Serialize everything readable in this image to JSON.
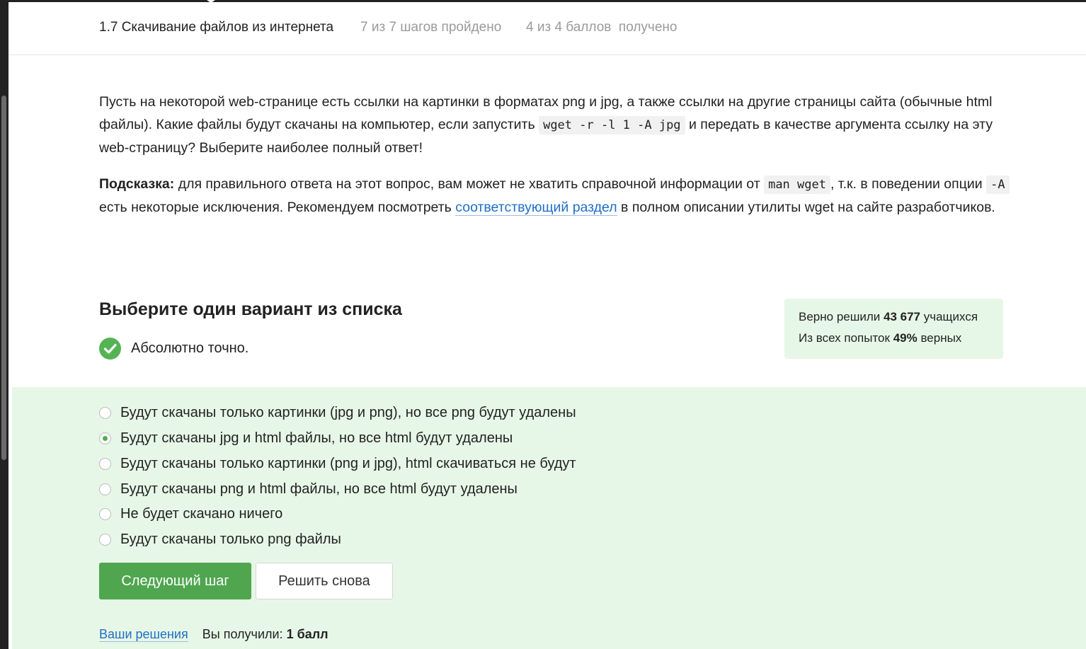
{
  "header": {
    "title": "1.7 Скачивание файлов из интернета",
    "steps": "7 из 7 шагов пройдено",
    "points": "4 из 4 баллов  получено"
  },
  "question": {
    "p1_part1": "Пусть на некоторой web-странице есть ссылки на картинки в форматах png и jpg, а также ссылки на другие страницы сайта (обычные html файлы). Какие файлы будут скачаны на компьютер, если запустить ",
    "p1_code": "wget -r -l 1 -A jpg",
    "p1_part2": " и передать в качестве аргумента ссылку на эту web-страницу? Выберите наиболее полный ответ!",
    "hint_label": "Подсказка:",
    "hint_part1": " для правильного ответа на этот вопрос, вам может не хватить справочной информации от ",
    "hint_code1": "man wget",
    "hint_part2": ", т.к. в поведении опции ",
    "hint_code2": "-A",
    "hint_part3": " есть некоторые исключения. Рекомендуем посмотреть ",
    "hint_link": "соответствующий раздел",
    "hint_part4": " в полном описании утилиты wget на сайте разработчиков."
  },
  "section": {
    "title": "Выберите один вариант из списка",
    "feedback": "Абсолютно точно."
  },
  "stats": {
    "solved_prefix": "Верно решили ",
    "solved_count": "43 677",
    "solved_suffix": " учащихся",
    "attempts_prefix": "Из всех попыток ",
    "attempts_percent": "49%",
    "attempts_suffix": " верных"
  },
  "options": [
    {
      "label": "Будут скачаны только картинки (jpg и png), но все png будут удалены",
      "selected": false
    },
    {
      "label": "Будут скачаны jpg и html файлы, но все html будут удалены",
      "selected": true
    },
    {
      "label": "Будут скачаны только картинки (png и jpg), html скачиваться не будут",
      "selected": false
    },
    {
      "label": "Будут скачаны png и html файлы, но все html будут удалены",
      "selected": false
    },
    {
      "label": "Не будет скачано ничего",
      "selected": false
    },
    {
      "label": "Будут скачаны только png файлы",
      "selected": false
    }
  ],
  "buttons": {
    "next": "Следующий шаг",
    "again": "Решить снова"
  },
  "footer": {
    "solutions_link": "Ваши решения",
    "received_label": "Вы получили: ",
    "received_value": "1 балл"
  },
  "colors": {
    "accent_green": "#4fa64f",
    "answer_background": "#e7f7e7",
    "link_blue": "#1f6fc5"
  },
  "icons": {
    "feedback": "check-circle-icon"
  }
}
